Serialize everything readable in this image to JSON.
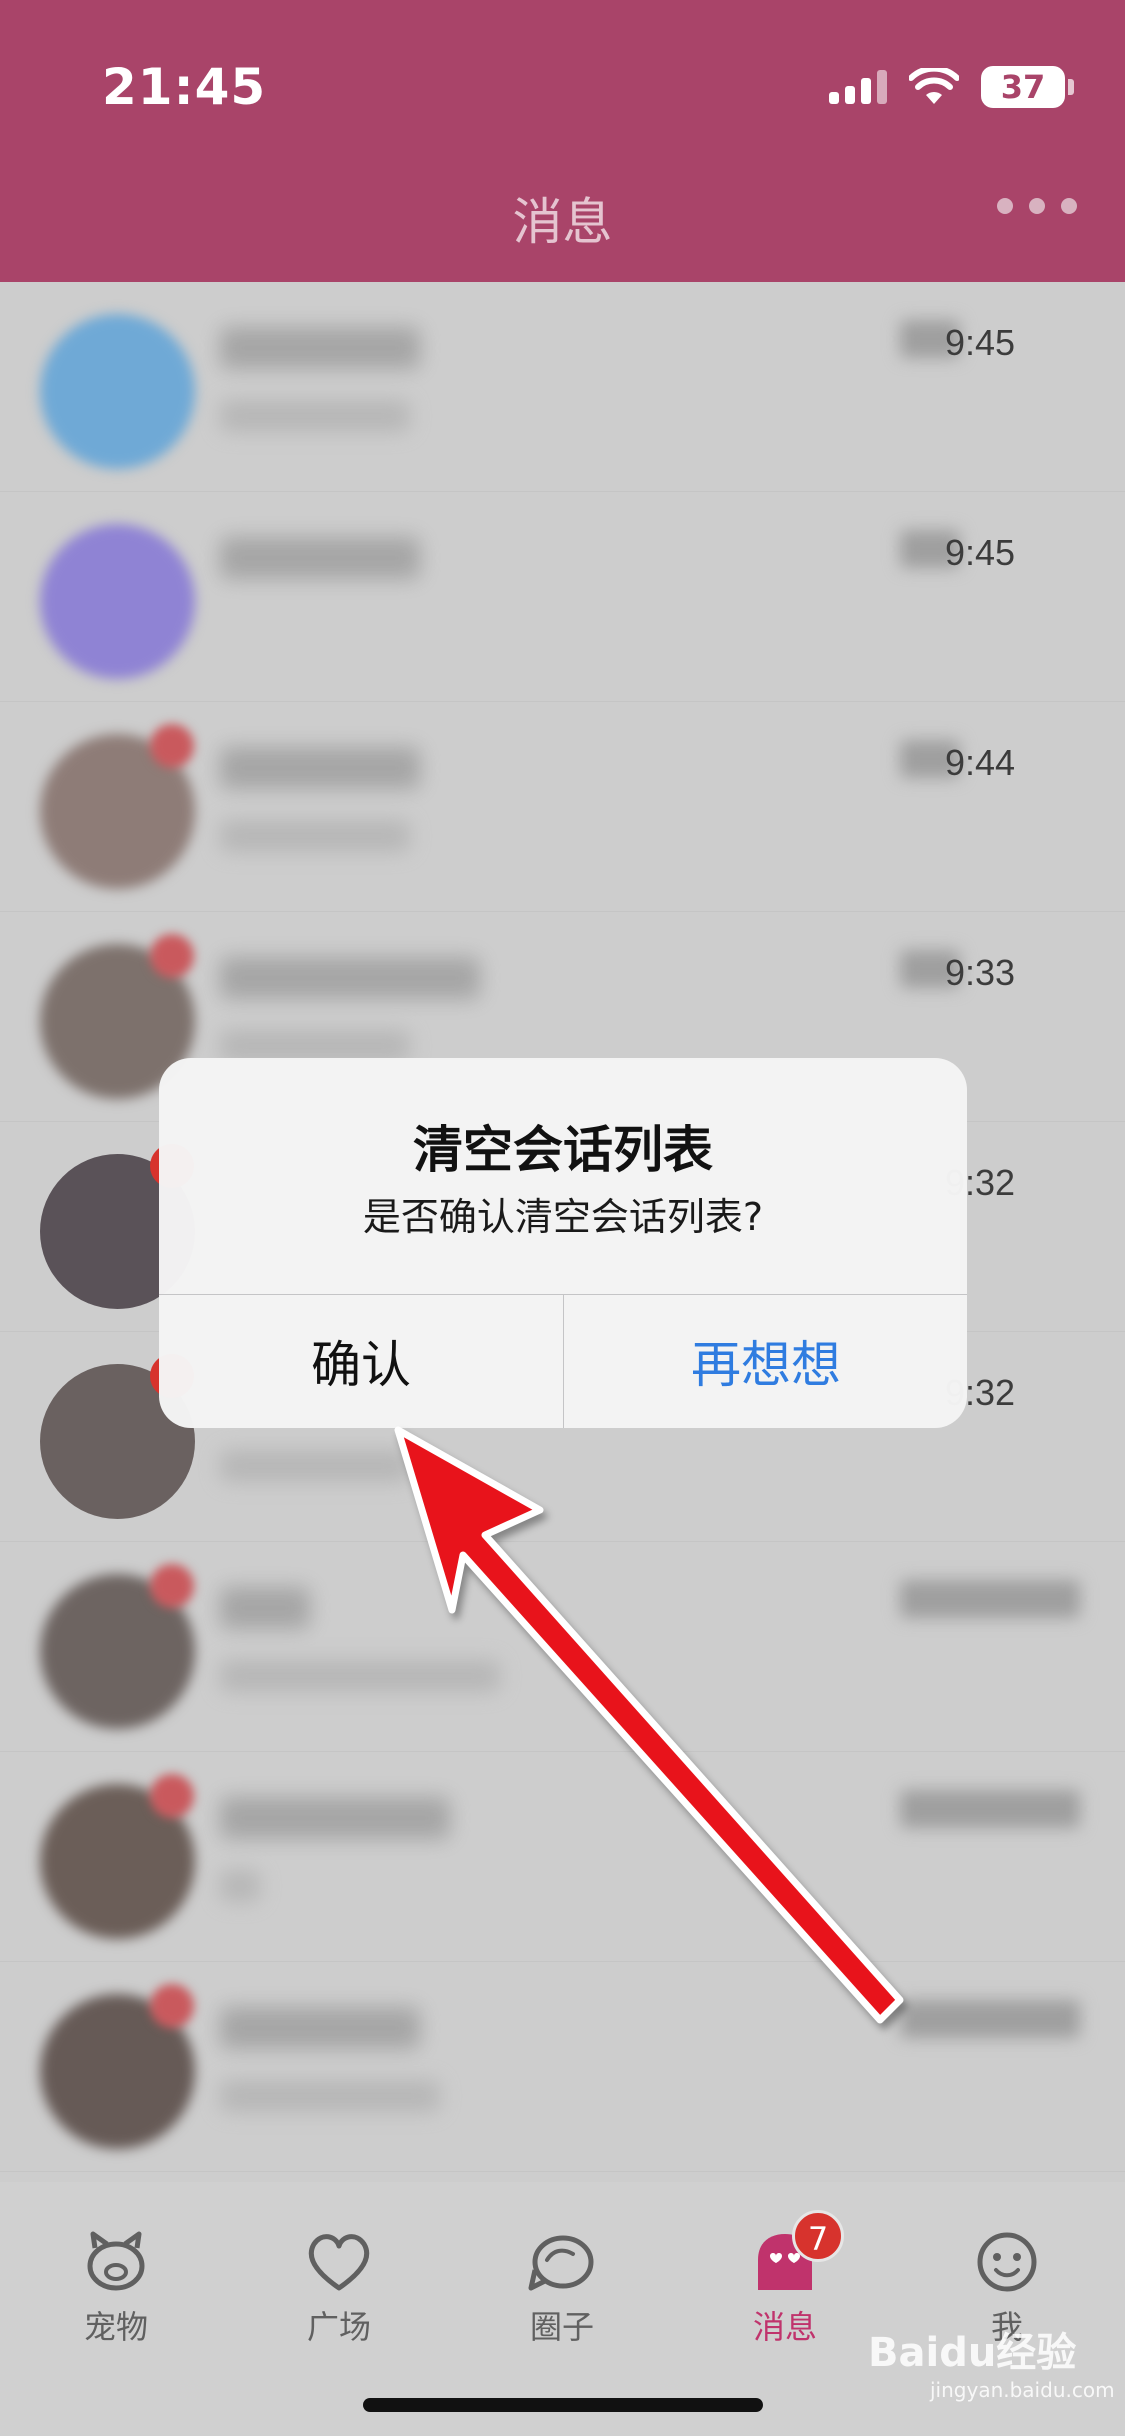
{
  "status_bar": {
    "time": "21:45",
    "battery": "37"
  },
  "header": {
    "title": "消息"
  },
  "conversations": [
    {
      "time": "9:45"
    },
    {
      "time": "9:45"
    },
    {
      "time": "9:44"
    },
    {
      "time": "9:33"
    },
    {
      "time": "9:32"
    },
    {
      "time": "9:32"
    },
    {
      "time": ""
    },
    {
      "time": ""
    },
    {
      "time": ""
    }
  ],
  "dialog": {
    "title": "清空会话列表",
    "message": "是否确认清空会话列表?",
    "confirm_label": "确认",
    "cancel_label": "再想想"
  },
  "tabbar": {
    "tabs": [
      {
        "label": "宠物",
        "icon": "pig-icon"
      },
      {
        "label": "广场",
        "icon": "heart-icon"
      },
      {
        "label": "圈子",
        "icon": "bubble-icon"
      },
      {
        "label": "消息",
        "icon": "message-face-icon",
        "badge": "7",
        "active": true
      },
      {
        "label": "我",
        "icon": "smiley-icon"
      }
    ]
  },
  "watermark": {
    "brand": "Baidu经验",
    "url": "jingyan.baidu.com"
  },
  "colors": {
    "header": "#a94469",
    "accent": "#c0336c",
    "link_blue": "#2f7ce0",
    "badge_red": "#d7332d",
    "arrow_red": "#e8131b"
  }
}
